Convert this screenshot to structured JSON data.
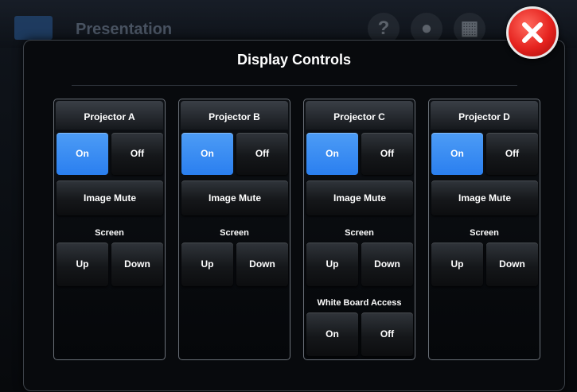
{
  "background": {
    "title": "Presentation",
    "icons": [
      "help-icon",
      "lightbulb-icon",
      "layout-icon"
    ]
  },
  "modal": {
    "title": "Display Controls",
    "close_icon": "close-icon"
  },
  "projectors": [
    {
      "name": "Projector A",
      "on_label": "On",
      "off_label": "Off",
      "power_state": "on",
      "mute_label": "Image Mute",
      "screen_label": "Screen",
      "up_label": "Up",
      "down_label": "Down"
    },
    {
      "name": "Projector B",
      "on_label": "On",
      "off_label": "Off",
      "power_state": "on",
      "mute_label": "Image Mute",
      "screen_label": "Screen",
      "up_label": "Up",
      "down_label": "Down"
    },
    {
      "name": "Projector C",
      "on_label": "On",
      "off_label": "Off",
      "power_state": "on",
      "mute_label": "Image Mute",
      "screen_label": "Screen",
      "up_label": "Up",
      "down_label": "Down",
      "whiteboard": {
        "label": "White Board Access",
        "on_label": "On",
        "off_label": "Off"
      }
    },
    {
      "name": "Projector D",
      "on_label": "On",
      "off_label": "Off",
      "power_state": "on",
      "mute_label": "Image Mute",
      "screen_label": "Screen",
      "up_label": "Up",
      "down_label": "Down"
    }
  ],
  "colors": {
    "accent": "#3b8ef2",
    "close": "#e5221e"
  }
}
